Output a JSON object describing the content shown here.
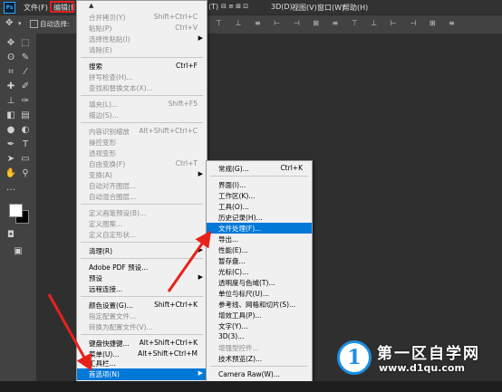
{
  "menubar": {
    "items": [
      "文件(F)",
      "编辑(E)",
      "(T)",
      "3D(D)",
      "视图(V)",
      "窗口(W)",
      "帮助(H)"
    ],
    "logo": "Ps"
  },
  "optionsbar": {
    "auto_select": "自动选择:"
  },
  "edit_menu": {
    "rows": [
      {
        "label": "合并拷贝(Y)",
        "shortcut": "Shift+Ctrl+C",
        "disabled": true
      },
      {
        "label": "粘贴(P)",
        "shortcut": "Ctrl+V",
        "disabled": true
      },
      {
        "label": "选择性粘贴(I)",
        "shortcut": "",
        "disabled": true,
        "submenu": true
      },
      {
        "label": "清除(E)",
        "shortcut": "",
        "disabled": true
      },
      {
        "label": "搜索",
        "shortcut": "Ctrl+F",
        "disabled": false
      },
      {
        "label": "拼写检查(H)...",
        "shortcut": "",
        "disabled": true
      },
      {
        "label": "查找和替换文本(X)...",
        "shortcut": "",
        "disabled": true
      },
      {
        "label": "填充(L)...",
        "shortcut": "Shift+F5",
        "disabled": true
      },
      {
        "label": "描边(S)...",
        "shortcut": "",
        "disabled": true
      },
      {
        "label": "内容识别缩放",
        "shortcut": "Alt+Shift+Ctrl+C",
        "disabled": true
      },
      {
        "label": "操控变形",
        "shortcut": "",
        "disabled": true
      },
      {
        "label": "透视变形",
        "shortcut": "",
        "disabled": true
      },
      {
        "label": "自由变换(F)",
        "shortcut": "Ctrl+T",
        "disabled": true
      },
      {
        "label": "变换(A)",
        "shortcut": "",
        "disabled": true,
        "submenu": true
      },
      {
        "label": "自动对齐图层...",
        "shortcut": "",
        "disabled": true
      },
      {
        "label": "自动混合图层...",
        "shortcut": "",
        "disabled": true
      },
      {
        "label": "定义画笔预设(B)...",
        "shortcut": "",
        "disabled": true
      },
      {
        "label": "定义图案...",
        "shortcut": "",
        "disabled": true
      },
      {
        "label": "定义自定形状...",
        "shortcut": "",
        "disabled": true
      },
      {
        "label": "清理(R)",
        "shortcut": "",
        "disabled": false,
        "submenu": true
      },
      {
        "label": "Adobe PDF 预设...",
        "shortcut": "",
        "disabled": false
      },
      {
        "label": "预设",
        "shortcut": "",
        "disabled": false,
        "submenu": true
      },
      {
        "label": "远程连接...",
        "shortcut": "",
        "disabled": false
      },
      {
        "label": "颜色设置(G)...",
        "shortcut": "Shift+Ctrl+K",
        "disabled": false
      },
      {
        "label": "指定配置文件...",
        "shortcut": "",
        "disabled": true
      },
      {
        "label": "转换为配置文件(V)...",
        "shortcut": "",
        "disabled": true
      },
      {
        "label": "键盘快捷键...",
        "shortcut": "Alt+Shift+Ctrl+K",
        "disabled": false
      },
      {
        "label": "菜单(U)...",
        "shortcut": "Alt+Shift+Ctrl+M",
        "disabled": false
      },
      {
        "label": "工具栏...",
        "shortcut": "",
        "disabled": false
      },
      {
        "label": "首选项(N)",
        "shortcut": "",
        "disabled": false,
        "submenu": true,
        "highlighted": true
      }
    ]
  },
  "prefs_menu": {
    "rows": [
      {
        "label": "常规(G)...",
        "shortcut": "Ctrl+K"
      },
      {
        "label": "界面(I)..."
      },
      {
        "label": "工作区(K)..."
      },
      {
        "label": "工具(O)..."
      },
      {
        "label": "历史记录(H)..."
      },
      {
        "label": "文件处理(F)...",
        "highlighted": true
      },
      {
        "label": "导出..."
      },
      {
        "label": "性能(E)..."
      },
      {
        "label": "暂存盘..."
      },
      {
        "label": "光标(C)..."
      },
      {
        "label": "透明度与色域(T)..."
      },
      {
        "label": "单位与标尺(U)..."
      },
      {
        "label": "参考线、网格和切片(S)..."
      },
      {
        "label": "增效工具(P)..."
      },
      {
        "label": "文字(Y)..."
      },
      {
        "label": "3D(3)..."
      },
      {
        "label": "增强型控件...",
        "disabled": true
      },
      {
        "label": "技术预览(Z)..."
      },
      {
        "label": "Camera Raw(W)..."
      }
    ]
  },
  "watermark": {
    "logo": "1",
    "title": "第一区自学网",
    "url": "www.d1qu.com"
  },
  "colors": {
    "highlight": "#0078d7",
    "annotation": "#e02020"
  }
}
